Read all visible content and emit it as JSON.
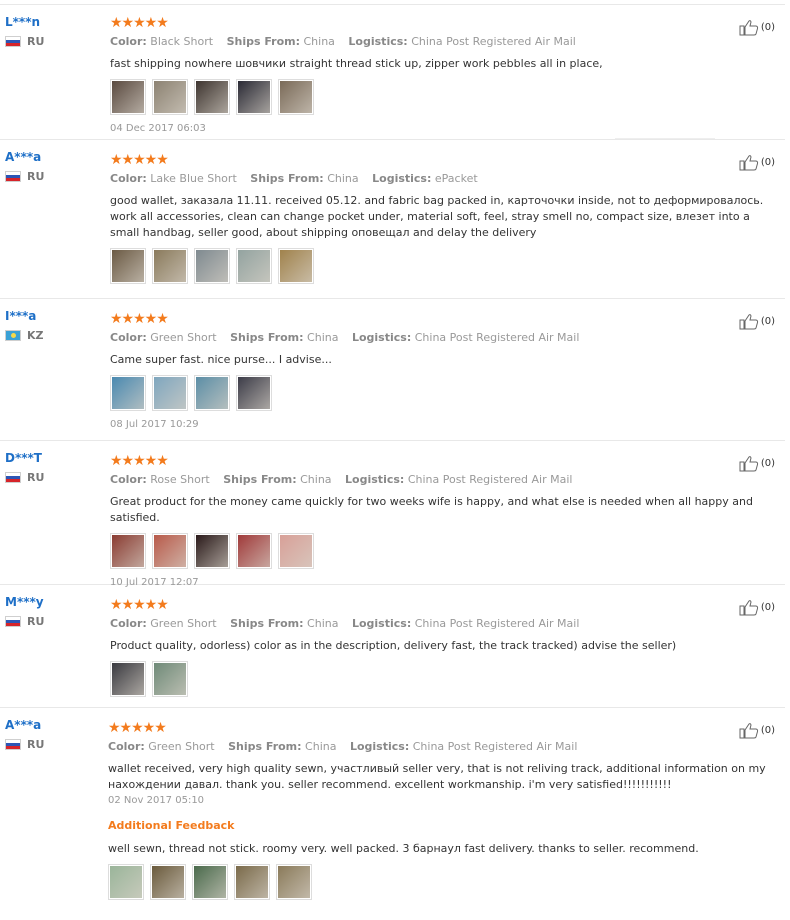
{
  "reviews": [
    {
      "user": "L***n",
      "country": "RU",
      "flag": "ru",
      "stars": "★★★★★",
      "color_label": "Color:",
      "color": "Black Short",
      "ships_label": "Ships From:",
      "ships": "China",
      "logistics_label": "Logistics:",
      "logistics": "China Post Registered Air Mail",
      "text": "fast shipping nowhere шовчики straight thread stick up, zipper work pebbles all in place,",
      "thumbs": [
        "#5a4a40",
        "#8c8272",
        "#3e3530",
        "#2a2a35",
        "#7a6a58"
      ],
      "date": "04 Dec 2017 06:03",
      "helpful": "(0)"
    },
    {
      "user": "A***a",
      "country": "RU",
      "flag": "ru",
      "stars": "★★★★★",
      "color_label": "Color:",
      "color": "Lake Blue Short",
      "ships_label": "Ships From:",
      "ships": "China",
      "logistics_label": "Logistics:",
      "logistics": "ePacket",
      "text": "good wallet, заказала 11.11. received 05.12. and fabric bag packed in, карточочки inside, not to деформировалось. work all accessories, clean can change pocket under, material soft, feel, stray smell no, compact size, влезет into a small handbag, seller good, about shipping оповещал and delay the delivery",
      "thumbs": [
        "#6b5a44",
        "#8a7a5c",
        "#7f8a90",
        "#93a3a0",
        "#a0824c"
      ],
      "helpful": "(0)"
    },
    {
      "user": "I***a",
      "country": "KZ",
      "flag": "kz",
      "stars": "★★★★★",
      "color_label": "Color:",
      "color": "Green Short",
      "ships_label": "Ships From:",
      "ships": "China",
      "logistics_label": "Logistics:",
      "logistics": "China Post Registered Air Mail",
      "text": "Came super fast. nice purse... I advise...",
      "thumbs": [
        "#4a89b0",
        "#7fa6be",
        "#5c8ea6",
        "#3c3c48"
      ],
      "date": "08 Jul 2017 10:29",
      "helpful": "(0)"
    },
    {
      "user": "D***T",
      "country": "RU",
      "flag": "ru",
      "stars": "★★★★★",
      "color_label": "Color:",
      "color": "Rose Short",
      "ships_label": "Ships From:",
      "ships": "China",
      "logistics_label": "Logistics:",
      "logistics": "China Post Registered Air Mail",
      "text": "Great product for the money came quickly for two weeks wife is happy, and what else is needed when all happy and satisfied.",
      "thumbs": [
        "#8a3c32",
        "#b85a4a",
        "#2a1a1a",
        "#a03a3a",
        "#d8a098"
      ],
      "date": "10 Jul 2017 12:07",
      "helpful": "(0)"
    },
    {
      "user": "M***y",
      "country": "RU",
      "flag": "ru",
      "stars": "★★★★★",
      "color_label": "Color:",
      "color": "Green Short",
      "ships_label": "Ships From:",
      "ships": "China",
      "logistics_label": "Logistics:",
      "logistics": "China Post Registered Air Mail",
      "text": "Product quality, odorless) color as in the description, delivery fast, the track tracked) advise the seller)",
      "thumbs": [
        "#3a3a40",
        "#6f8a78"
      ],
      "helpful": "(0)"
    },
    {
      "user": "A***a",
      "country": "RU",
      "flag": "ru",
      "stars": "★★★★★",
      "color_label": "Color:",
      "color": "Green Short",
      "ships_label": "Ships From:",
      "ships": "China",
      "logistics_label": "Logistics:",
      "logistics": "China Post Registered Air Mail",
      "text": "wallet received, very high quality sewn, участливый seller very, that is not reliving track, additional information on my нахождении давал. thank you. seller recommend. excellent workmanship. i'm very satisfied!!!!!!!!!!!",
      "date": "02 Nov 2017 05:10",
      "additional_label": "Additional Feedback",
      "additional_text": "well sewn, thread not stick. roomy very. well packed. 3 барнаул fast delivery. thanks to seller. recommend.",
      "thumbs": [
        "#9ab59a",
        "#6a5a3c",
        "#4a6a4c",
        "#7a6a4a",
        "#8a7a5a"
      ],
      "helpful": "(0)"
    }
  ]
}
